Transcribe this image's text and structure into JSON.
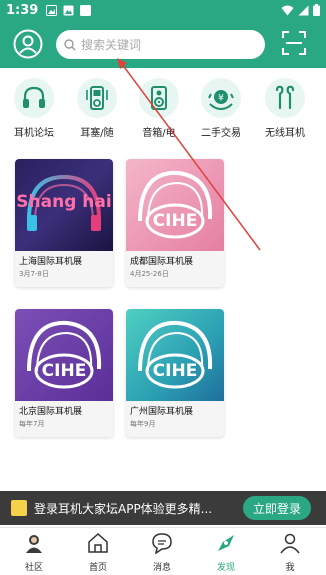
{
  "status_bar": {
    "time": "1:39"
  },
  "header": {
    "search_placeholder": "搜索关键词"
  },
  "categories": [
    {
      "label": "耳机论坛",
      "icon": "headphones-icon"
    },
    {
      "label": "耳塞/随",
      "icon": "music-player-icon"
    },
    {
      "label": "音箱/电",
      "icon": "speaker-icon"
    },
    {
      "label": "二手交易",
      "icon": "trade-exchange-icon"
    },
    {
      "label": "无线耳机",
      "icon": "wireless-earbuds-icon"
    }
  ],
  "cards": [
    {
      "title": "上海国际耳机展",
      "date": "3月7-8日",
      "logo_text": "Shang hai",
      "theme": "shanghai"
    },
    {
      "title": "成都国际耳机展",
      "date": "4月25-26日",
      "logo_text": "CIHE",
      "theme": "chengdu"
    },
    {
      "title": "北京国际耳机展",
      "date": "每年7月",
      "logo_text": "CIHE",
      "theme": "beijing"
    },
    {
      "title": "广州国际耳机展",
      "date": "每年9月",
      "logo_text": "CIHE",
      "theme": "guangzhou"
    }
  ],
  "banner": {
    "text": "登录耳机大家坛APP体验更多精...",
    "login_label": "立即登录"
  },
  "nav": [
    {
      "label": "社区",
      "icon": "community-icon",
      "active": false
    },
    {
      "label": "首页",
      "icon": "home-icon",
      "active": false
    },
    {
      "label": "消息",
      "icon": "message-icon",
      "active": false
    },
    {
      "label": "发现",
      "icon": "discover-icon",
      "active": true
    },
    {
      "label": "我",
      "icon": "profile-icon",
      "active": false
    }
  ],
  "colors": {
    "brand": "#2aa783",
    "banner_bg": "#3b3b3b",
    "annotation_arrow": "#e0403a"
  }
}
